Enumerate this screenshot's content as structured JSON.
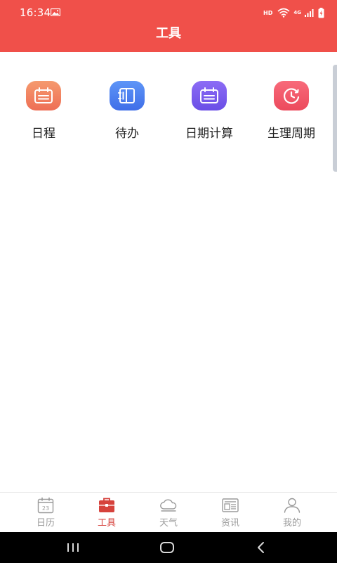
{
  "status_bar": {
    "time": "16:34",
    "hd": "HD",
    "network": "4G"
  },
  "header": {
    "title": "工具"
  },
  "tools": [
    {
      "label": "日程",
      "icon": "calendar-icon",
      "color": "#f07a5a"
    },
    {
      "label": "待办",
      "icon": "notebook-icon",
      "color": "#4d7ff0"
    },
    {
      "label": "日期计算",
      "icon": "calendar-calc-icon",
      "color": "#7a5cf0"
    },
    {
      "label": "生理周期",
      "icon": "cycle-clock-icon",
      "color": "#f2566a"
    }
  ],
  "tabbar": {
    "active": 1,
    "accent": "#d6423c",
    "items": [
      {
        "label": "日历",
        "icon": "calendar-icon",
        "badge": "23"
      },
      {
        "label": "工具",
        "icon": "toolbox-icon"
      },
      {
        "label": "天气",
        "icon": "cloud-icon"
      },
      {
        "label": "资讯",
        "icon": "news-icon"
      },
      {
        "label": "我的",
        "icon": "person-icon"
      }
    ]
  }
}
